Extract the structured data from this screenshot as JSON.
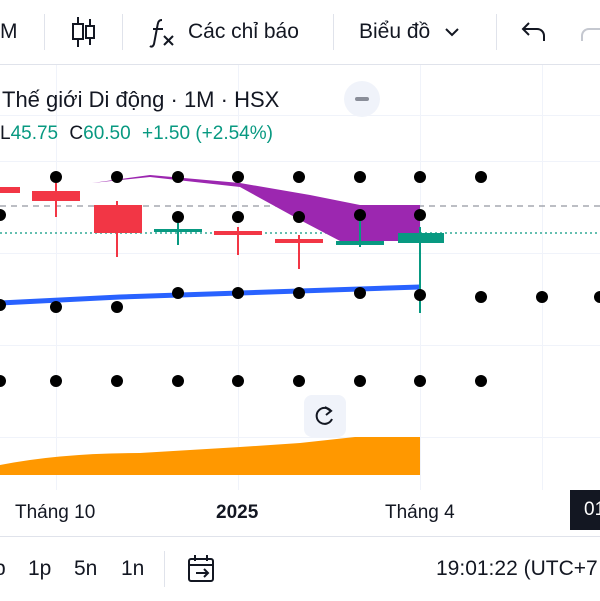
{
  "toolbar": {
    "interval_label": "M",
    "indicators_label": "Các chỉ báo",
    "chart_type_label": "Biểu đồ"
  },
  "legend": {
    "title": "Thế giới Di động · 1M · HSX",
    "low_prefix": "L",
    "low_value": "45.75",
    "close_prefix": "C",
    "close_value": "60.50",
    "change": "+1.50 (+2.54%)"
  },
  "time_axis": {
    "labels": [
      "Tháng 10",
      "2025",
      "Tháng 4"
    ],
    "cursor_badge": "01"
  },
  "bottom_bar": {
    "ranges": [
      "p",
      "1p",
      "5n",
      "1n"
    ],
    "clock": "19:01:22 (UTC+7"
  },
  "colors": {
    "up": "#089981",
    "down": "#f23645",
    "cloud": "#9c27b0",
    "line": "#2962ff",
    "area": "#ff9800",
    "dots": "#000000"
  },
  "icons": [
    "candles-icon",
    "function-icon",
    "chevron-down-icon",
    "undo-icon",
    "redo-icon",
    "collapse-icon",
    "reset-icon",
    "date-range-icon"
  ]
}
